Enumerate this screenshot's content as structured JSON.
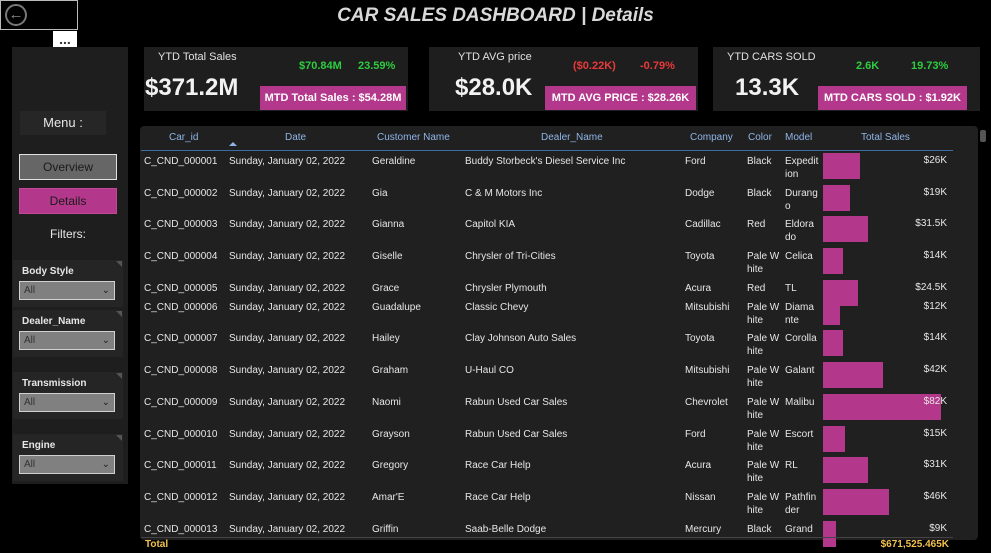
{
  "header": {
    "title": "CAR SALES DASHBOARD | Details",
    "back_icon": "back-arrow-icon",
    "more_label": "..."
  },
  "sidebar": {
    "menu_label": "Menu :",
    "nav": {
      "overview": "Overview",
      "details": "Details",
      "active": "Details"
    },
    "filters_label": "Filters:",
    "filters": [
      {
        "label": "Body Style",
        "value": "All"
      },
      {
        "label": "Dealer_Name",
        "value": "All"
      },
      {
        "label": "Transmission",
        "value": "All"
      },
      {
        "label": "Engine",
        "value": "All"
      }
    ]
  },
  "kpis": [
    {
      "title": "YTD Total Sales",
      "value": "$371.2M",
      "delta_abs": "$70.84M",
      "delta_pct": "23.59%",
      "delta_color": "#2ecc40",
      "mtd": "MTD Total Sales : $54.28M"
    },
    {
      "title": "YTD AVG price",
      "value": "$28.0K",
      "delta_abs": "($0.22K)",
      "delta_pct": "-0.79%",
      "delta_color": "#e83a3a",
      "mtd": "MTD AVG PRICE : $28.26K"
    },
    {
      "title": "YTD CARS SOLD",
      "value": "13.3K",
      "delta_abs": "2.6K",
      "delta_pct": "19.73%",
      "delta_color": "#2ecc40",
      "mtd": "MTD CARS SOLD : $1.92K"
    }
  ],
  "table": {
    "columns": [
      "Car_id",
      "Date",
      "Customer Name",
      "Dealer_Name",
      "Company",
      "Color",
      "Model",
      "Total Sales"
    ],
    "sort_column": "Date",
    "bar_color": "#b3378a",
    "bar_max": 82000,
    "rows": [
      {
        "car_id": "C_CND_000001",
        "date": "Sunday, January 02, 2022",
        "customer": "Geraldine",
        "dealer": "Buddy Storbeck's Diesel Service Inc",
        "company": "Ford",
        "color": "Black",
        "model": "Expedition",
        "sales": "$26K",
        "amount": 26000
      },
      {
        "car_id": "C_CND_000002",
        "date": "Sunday, January 02, 2022",
        "customer": "Gia",
        "dealer": "C & M Motors Inc",
        "company": "Dodge",
        "color": "Black",
        "model": "Durango",
        "sales": "$19K",
        "amount": 19000
      },
      {
        "car_id": "C_CND_000003",
        "date": "Sunday, January 02, 2022",
        "customer": "Gianna",
        "dealer": "Capitol KIA",
        "company": "Cadillac",
        "color": "Red",
        "model": "Eldorado",
        "sales": "$31.5K",
        "amount": 31500
      },
      {
        "car_id": "C_CND_000004",
        "date": "Sunday, January 02, 2022",
        "customer": "Giselle",
        "dealer": "Chrysler of Tri-Cities",
        "company": "Toyota",
        "color": "Pale White",
        "model": "Celica",
        "sales": "$14K",
        "amount": 14000
      },
      {
        "car_id": "C_CND_000005",
        "date": "Sunday, January 02, 2022",
        "customer": "Grace",
        "dealer": "Chrysler Plymouth",
        "company": "Acura",
        "color": "Red",
        "model": "TL",
        "sales": "$24.5K",
        "amount": 24500
      },
      {
        "car_id": "C_CND_000006",
        "date": "Sunday, January 02, 2022",
        "customer": "Guadalupe",
        "dealer": "Classic Chevy",
        "company": "Mitsubishi",
        "color": "Pale White",
        "model": "Diamante",
        "sales": "$12K",
        "amount": 12000
      },
      {
        "car_id": "C_CND_000007",
        "date": "Sunday, January 02, 2022",
        "customer": "Hailey",
        "dealer": "Clay Johnson Auto Sales",
        "company": "Toyota",
        "color": "Pale White",
        "model": "Corolla",
        "sales": "$14K",
        "amount": 14000
      },
      {
        "car_id": "C_CND_000008",
        "date": "Sunday, January 02, 2022",
        "customer": "Graham",
        "dealer": "U-Haul CO",
        "company": "Mitsubishi",
        "color": "Pale White",
        "model": "Galant",
        "sales": "$42K",
        "amount": 42000
      },
      {
        "car_id": "C_CND_000009",
        "date": "Sunday, January 02, 2022",
        "customer": "Naomi",
        "dealer": "Rabun Used Car Sales",
        "company": "Chevrolet",
        "color": "Pale White",
        "model": "Malibu",
        "sales": "$82K",
        "amount": 82000
      },
      {
        "car_id": "C_CND_000010",
        "date": "Sunday, January 02, 2022",
        "customer": "Grayson",
        "dealer": "Rabun Used Car Sales",
        "company": "Ford",
        "color": "Pale White",
        "model": "Escort",
        "sales": "$15K",
        "amount": 15000
      },
      {
        "car_id": "C_CND_000011",
        "date": "Sunday, January 02, 2022",
        "customer": "Gregory",
        "dealer": "Race Car Help",
        "company": "Acura",
        "color": "Pale White",
        "model": "RL",
        "sales": "$31K",
        "amount": 31000
      },
      {
        "car_id": "C_CND_000012",
        "date": "Sunday, January 02, 2022",
        "customer": "Amar'E",
        "dealer": "Race Car Help",
        "company": "Nissan",
        "color": "Pale White",
        "model": "Pathfinder",
        "sales": "$46K",
        "amount": 46000
      },
      {
        "car_id": "C_CND_000013",
        "date": "Sunday, January 02, 2022",
        "customer": "Griffin",
        "dealer": "Saab-Belle Dodge",
        "company": "Mercury",
        "color": "Black",
        "model": "Grand",
        "sales": "$9K",
        "amount": 9000
      }
    ],
    "total_label": "Total",
    "total_value": "$671,525.465K"
  }
}
